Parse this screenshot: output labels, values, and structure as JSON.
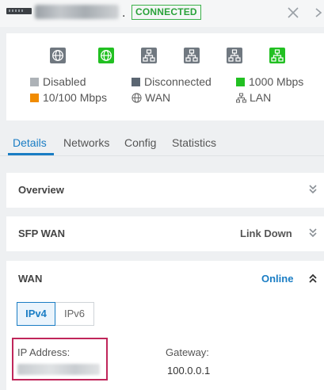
{
  "header": {
    "status": "CONNECTED",
    "separator": "."
  },
  "ports": [
    {
      "kind": "wan",
      "state": "disabled",
      "color": "#707880"
    },
    {
      "kind": "wan",
      "state": "1000",
      "color": "#22c022"
    },
    {
      "kind": "lan",
      "state": "disabled",
      "color": "#707880"
    },
    {
      "kind": "lan",
      "state": "disabled",
      "color": "#707880"
    },
    {
      "kind": "lan",
      "state": "disabled",
      "color": "#707880"
    },
    {
      "kind": "lan",
      "state": "1000",
      "color": "#22c022"
    }
  ],
  "legend": {
    "disabled": "Disabled",
    "disconnected": "Disconnected",
    "speed_1000": "1000 Mbps",
    "speed_10_100": "10/100 Mbps",
    "wan": "WAN",
    "lan": "LAN",
    "colors": {
      "disabled": "#adb2b7",
      "disconnected": "#5b6672",
      "speed_1000": "#22c022",
      "speed_10_100": "#f08b00"
    }
  },
  "tabs": [
    {
      "label": "Details",
      "active": true
    },
    {
      "label": "Networks",
      "active": false
    },
    {
      "label": "Config",
      "active": false
    },
    {
      "label": "Statistics",
      "active": false
    }
  ],
  "panels": {
    "overview": {
      "title": "Overview"
    },
    "sfp_wan": {
      "title": "SFP WAN",
      "status": "Link Down"
    },
    "wan": {
      "title": "WAN",
      "status": "Online"
    }
  },
  "wan": {
    "ip_tabs": [
      "IPv4",
      "IPv6"
    ],
    "ip_address_label": "IP Address:",
    "gateway_label": "Gateway:",
    "gateway_value": "100.0.0.1"
  },
  "accent_color": "#1a7dc4"
}
